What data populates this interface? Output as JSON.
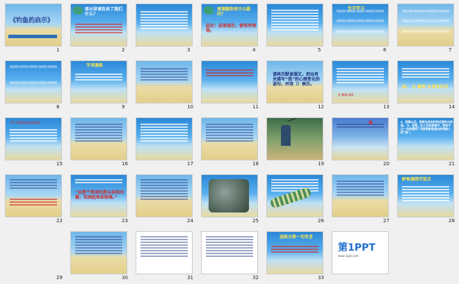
{
  "slides": [
    {
      "n": "1",
      "title": "《钓鱼的启示》"
    },
    {
      "n": "2",
      "text": "单元导读告诉了我们什么？"
    },
    {
      "n": "3",
      "text": ""
    },
    {
      "n": "4",
      "text": "读课题你有什么疑问？",
      "sub": "启示：启发指示，使有所领悟。"
    },
    {
      "n": "5",
      "text": ""
    },
    {
      "n": "6",
      "text": "生字学习"
    },
    {
      "n": "7",
      "text": ""
    },
    {
      "n": "8",
      "text": ""
    },
    {
      "n": "9",
      "text": "字词演练"
    },
    {
      "n": "10",
      "text": ""
    },
    {
      "n": "11",
      "text": ""
    },
    {
      "n": "12",
      "text": "请再次默读课文，把出有关描写“我”的心理变化的语句，并用（）表示。"
    },
    {
      "n": "13",
      "text": "鱼 暴跳 满身"
    },
    {
      "n": "14",
      "text": "知。 大 暴亮 头来张天试"
    },
    {
      "n": "15",
      "text": "“我”不留宿会有的原因是"
    },
    {
      "n": "16",
      "text": ""
    },
    {
      "n": "17",
      "text": ""
    },
    {
      "n": "18",
      "text": ""
    },
    {
      "n": "19",
      "text": ""
    },
    {
      "n": "20",
      "text": "鱼"
    },
    {
      "n": "21",
      "text": "a、那晚以后，我再也没有钓到过那样大的鱼。 b、但是，在人生的旅途中，我却不止一次地遇到了与那条鲈鱼相似的诱惑人的“鱼”。"
    },
    {
      "n": "22",
      "text": ""
    },
    {
      "n": "23",
      "text": "“这是个简单的是与非的问题，实践起来却很难。”"
    },
    {
      "n": "24",
      "text": ""
    },
    {
      "n": "25",
      "text": ""
    },
    {
      "n": "26",
      "text": ""
    },
    {
      "n": "27",
      "text": ""
    },
    {
      "n": "28",
      "text": "鲈鱼捕捞开放日"
    },
    {
      "n": "29",
      "text": ""
    },
    {
      "n": "30",
      "text": ""
    },
    {
      "n": "31",
      "text": ""
    },
    {
      "n": "32",
      "text": "送给大家一句名言"
    },
    {
      "n": "33",
      "text": "第1PPT",
      "sub": "www.1ppt.com"
    }
  ]
}
